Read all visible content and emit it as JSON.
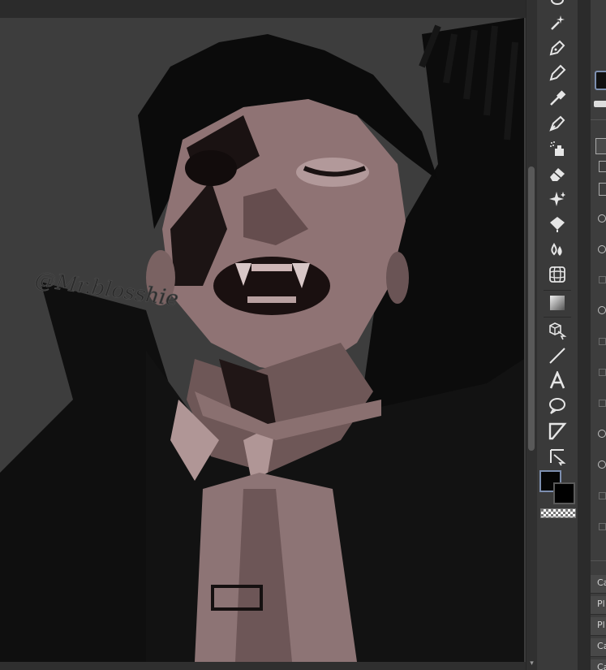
{
  "canvas": {
    "watermark": "@Mr.blosshie"
  },
  "toolbar": {
    "tools": [
      {
        "name": "lasso-select-tool-icon",
        "top": 0
      },
      {
        "name": "magic-wand-icon"
      },
      {
        "name": "pen-tool-icon"
      },
      {
        "name": "pencil-tool-icon"
      },
      {
        "name": "eyedropper-icon"
      },
      {
        "name": "brush-tool-icon"
      },
      {
        "name": "airbrush-icon"
      },
      {
        "name": "eraser-icon"
      },
      {
        "name": "decoration-sparkle-icon"
      },
      {
        "name": "fill-bucket-icon"
      },
      {
        "name": "blend-drops-icon"
      },
      {
        "name": "mesh-transform-icon"
      },
      {
        "name": "gradient-icon"
      },
      {
        "name": "3d-object-icon"
      },
      {
        "name": "line-figure-icon"
      },
      {
        "name": "text-tool-icon"
      },
      {
        "name": "speech-balloon-icon"
      },
      {
        "name": "frame-border-icon"
      },
      {
        "name": "ruler-tool-icon"
      }
    ],
    "main_color": "#050505",
    "sub_color": "#000000",
    "accent": "#7d8fb0"
  },
  "right_panel": {
    "labels": [
      "Ca",
      "Pl",
      "Pl",
      "Ca",
      "Ca"
    ]
  }
}
